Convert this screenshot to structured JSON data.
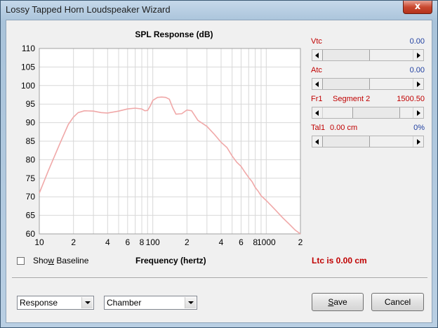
{
  "window": {
    "title": "Lossy Tapped Horn Loudspeaker Wizard",
    "close_symbol": "x"
  },
  "chart_data": {
    "type": "line",
    "title": "SPL Response (dB)",
    "xlabel": "Frequency (hertz)",
    "ylabel": "",
    "x_scale": "log",
    "xlim": [
      10,
      2000
    ],
    "ylim": [
      60,
      110
    ],
    "y_ticks": [
      "110",
      "105",
      "100",
      "95",
      "90",
      "85",
      "80",
      "75",
      "70",
      "65",
      "60"
    ],
    "x_ticks": [
      {
        "value": 10,
        "label": "10"
      },
      {
        "value": 20,
        "label": "2"
      },
      {
        "value": 40,
        "label": "4"
      },
      {
        "value": 60,
        "label": "6"
      },
      {
        "value": 80,
        "label": "8"
      },
      {
        "value": 100,
        "label": "100"
      },
      {
        "value": 200,
        "label": "2"
      },
      {
        "value": 400,
        "label": "4"
      },
      {
        "value": 600,
        "label": "6"
      },
      {
        "value": 800,
        "label": "8"
      },
      {
        "value": 1000,
        "label": "1000"
      },
      {
        "value": 2000,
        "label": "2"
      }
    ],
    "grid": true,
    "line_color": "#f0a8a8",
    "series": [
      {
        "x": [
          10,
          12,
          15,
          18,
          20,
          22,
          25,
          30,
          35,
          40,
          50,
          60,
          70,
          80,
          85,
          90,
          95,
          100,
          110,
          120,
          130,
          140,
          150,
          160,
          180,
          200,
          220,
          250,
          300,
          350,
          400,
          450,
          500,
          550,
          600,
          650,
          700,
          750,
          800,
          850,
          900,
          1000,
          1100,
          1200,
          1400,
          1600,
          1800,
          2000
        ],
        "y": [
          71,
          77,
          84,
          89.5,
          91.5,
          92.7,
          93.2,
          93.1,
          92.7,
          92.6,
          93.1,
          93.7,
          93.9,
          93.7,
          93.2,
          93.3,
          94.5,
          96,
          96.8,
          96.9,
          96.8,
          96.3,
          94,
          92.3,
          92.4,
          93.4,
          93.2,
          90.6,
          89,
          86.8,
          84.7,
          83.3,
          81,
          79.3,
          78.2,
          76.6,
          75.2,
          74.1,
          72.5,
          71.5,
          70.3,
          69,
          67.7,
          66.5,
          64.3,
          62.6,
          61,
          60
        ]
      }
    ]
  },
  "sliders": [
    {
      "label": "Vtc",
      "value": "0.00",
      "thumb_position": 0.0
    },
    {
      "label": "Atc",
      "value": "0.00",
      "thumb_position": 0.0
    },
    {
      "label": "Fr1",
      "sublabel": "Segment 2",
      "value": "1500.50",
      "thumb_position": 0.47
    },
    {
      "label": "Tal1",
      "sublabel": "0.00 cm",
      "value": "0%",
      "thumb_position": 0.0
    }
  ],
  "show_baseline": {
    "label_before": "Sho",
    "mnemonic": "w",
    "label_after": " Baseline",
    "checked": false
  },
  "ltc_status": "Ltc is 0.00 cm",
  "dropdowns": {
    "view": "Response",
    "component": "Chamber"
  },
  "buttons": {
    "save_mnemonic": "S",
    "save_rest": "ave",
    "cancel": "Cancel"
  },
  "colors": {
    "slider_label": "#c00000",
    "slider_value": "#1f3fa0",
    "curve": "#f0a8a8"
  }
}
